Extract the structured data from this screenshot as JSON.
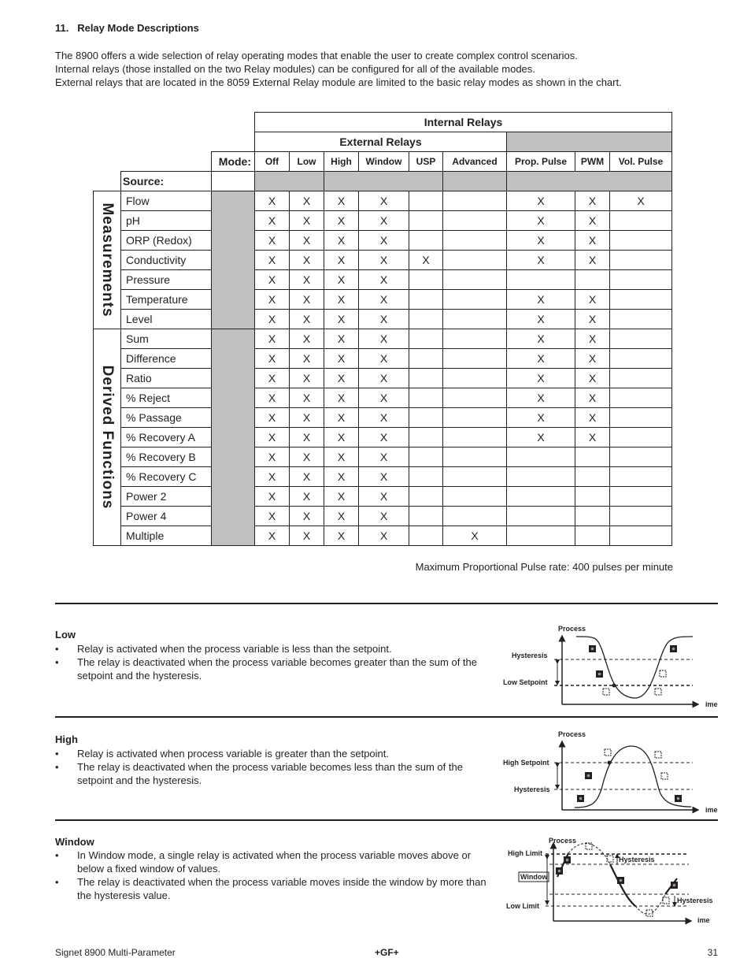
{
  "section": {
    "number": "11.",
    "title": "Relay Mode Descriptions"
  },
  "intro": [
    "The 8900 offers a wide selection of relay operating modes that enable the user to create complex control scenarios.",
    "Internal relays (those installed on the two Relay modules) can be configured for all of the available modes.",
    "External relays that are located in the 8059 External Relay module are limited to the basic relay modes as shown in the chart."
  ],
  "table": {
    "internal_header": "Internal Relays",
    "external_header": "External Relays",
    "mode_label": "Mode:",
    "source_label": "Source:",
    "modes": [
      "Off",
      "Low",
      "High",
      "Window",
      "USP",
      "Advanced",
      "Prop. Pulse",
      "PWM",
      "Vol. Pulse"
    ],
    "groups": [
      {
        "label": "Measurements",
        "rows": [
          {
            "source": "Flow",
            "marks": [
              "X",
              "X",
              "X",
              "X",
              "",
              "",
              "X",
              "X",
              "X"
            ]
          },
          {
            "source": "pH",
            "marks": [
              "X",
              "X",
              "X",
              "X",
              "",
              "",
              "X",
              "X",
              ""
            ]
          },
          {
            "source": "ORP (Redox)",
            "marks": [
              "X",
              "X",
              "X",
              "X",
              "",
              "",
              "X",
              "X",
              ""
            ]
          },
          {
            "source": "Conductivity",
            "marks": [
              "X",
              "X",
              "X",
              "X",
              "X",
              "",
              "X",
              "X",
              ""
            ]
          },
          {
            "source": "Pressure",
            "marks": [
              "X",
              "X",
              "X",
              "X",
              "",
              "",
              "",
              "",
              ""
            ]
          },
          {
            "source": "Temperature",
            "marks": [
              "X",
              "X",
              "X",
              "X",
              "",
              "",
              "X",
              "X",
              ""
            ]
          },
          {
            "source": "Level",
            "marks": [
              "X",
              "X",
              "X",
              "X",
              "",
              "",
              "X",
              "X",
              ""
            ]
          }
        ]
      },
      {
        "label": "Derived Functions",
        "rows": [
          {
            "source": "Sum",
            "marks": [
              "X",
              "X",
              "X",
              "X",
              "",
              "",
              "X",
              "X",
              ""
            ]
          },
          {
            "source": "Difference",
            "marks": [
              "X",
              "X",
              "X",
              "X",
              "",
              "",
              "X",
              "X",
              ""
            ]
          },
          {
            "source": "Ratio",
            "marks": [
              "X",
              "X",
              "X",
              "X",
              "",
              "",
              "X",
              "X",
              ""
            ]
          },
          {
            "source": "% Reject",
            "marks": [
              "X",
              "X",
              "X",
              "X",
              "",
              "",
              "X",
              "X",
              ""
            ]
          },
          {
            "source": "% Passage",
            "marks": [
              "X",
              "X",
              "X",
              "X",
              "",
              "",
              "X",
              "X",
              ""
            ]
          },
          {
            "source": "% Recovery A",
            "marks": [
              "X",
              "X",
              "X",
              "X",
              "",
              "",
              "X",
              "X",
              ""
            ]
          },
          {
            "source": "% Recovery B",
            "marks": [
              "X",
              "X",
              "X",
              "X",
              "",
              "",
              "",
              "",
              ""
            ]
          },
          {
            "source": "% Recovery C",
            "marks": [
              "X",
              "X",
              "X",
              "X",
              "",
              "",
              "",
              "",
              ""
            ]
          },
          {
            "source": "Power 2",
            "marks": [
              "X",
              "X",
              "X",
              "X",
              "",
              "",
              "",
              "",
              ""
            ]
          },
          {
            "source": "Power 4",
            "marks": [
              "X",
              "X",
              "X",
              "X",
              "",
              "",
              "",
              "",
              ""
            ]
          },
          {
            "source": "Multiple",
            "marks": [
              "X",
              "X",
              "X",
              "X",
              "",
              "X",
              "",
              "",
              ""
            ]
          }
        ]
      }
    ],
    "note": "Maximum Proportional Pulse rate: 400 pulses per minute"
  },
  "modes_desc": [
    {
      "title": "Low",
      "bullets": [
        "Relay is activated when the process variable is less than the setpoint.",
        "The relay is deactivated when the process variable becomes greater than the sum of the setpoint and the hysteresis."
      ],
      "diagram": {
        "y_label": "Process",
        "x_label": "ime",
        "upper_label": "Hysteresis",
        "lower_label": "Low Setpoint"
      }
    },
    {
      "title": "High",
      "bullets": [
        "Relay is activated when process variable is greater than the setpoint.",
        "The relay is deactivated when the process variable becomes less than the sum of the setpoint and the hysteresis."
      ],
      "diagram": {
        "y_label": "Process",
        "x_label": "ime",
        "upper_label": "High Setpoint",
        "lower_label": "Hysteresis"
      }
    },
    {
      "title": "Window",
      "bullets": [
        "In Window mode, a single relay is activated when the process variable moves above or below a fixed window of values.",
        "The relay is deactivated when the process variable moves inside the window by more than the hysteresis value."
      ],
      "diagram": {
        "y_label": "Process",
        "x_label": "ime",
        "high_label": "High Limit",
        "low_label": "Low Limit",
        "window_label": "Window",
        "hyst_label_1": "Hysteresis",
        "hyst_label_2": "Hysteresis"
      }
    }
  ],
  "footer": {
    "left": "Signet 8900 Multi-Parameter",
    "logo": "+GF+",
    "page": "31"
  }
}
